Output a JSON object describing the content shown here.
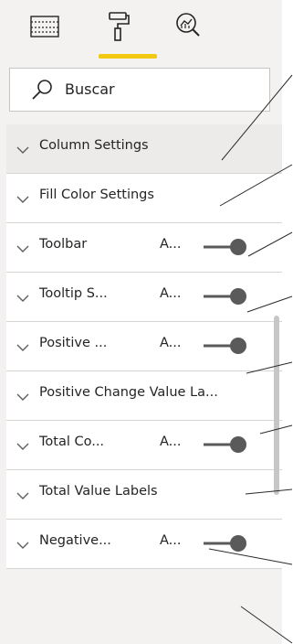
{
  "tabs": [
    {
      "name": "fields-tab",
      "icon": "table-icon",
      "active": false
    },
    {
      "name": "format-tab",
      "icon": "paint-roller-icon",
      "active": true
    },
    {
      "name": "analytics-tab",
      "icon": "analytics-magnifier-icon",
      "active": false
    }
  ],
  "search": {
    "label": "Buscar"
  },
  "cards": [
    {
      "title": "Column Settings",
      "state": "",
      "toggle": false,
      "hover": true
    },
    {
      "title": "Fill Color Settings",
      "state": "",
      "toggle": false,
      "hover": false
    },
    {
      "title": "Toolbar",
      "state": "A...",
      "toggle": true,
      "hover": false
    },
    {
      "title": "Tooltip S...",
      "state": "A...",
      "toggle": true,
      "hover": false
    },
    {
      "title": "Positive ...",
      "state": "A...",
      "toggle": true,
      "hover": false
    },
    {
      "title": "Positive Change Value La...",
      "state": "",
      "toggle": false,
      "hover": false
    },
    {
      "title": "Total Co...",
      "state": "A...",
      "toggle": true,
      "hover": false
    },
    {
      "title": "Total Value Labels",
      "state": "",
      "toggle": false,
      "hover": false
    },
    {
      "title": "Negative...",
      "state": "A...",
      "toggle": true,
      "hover": false
    }
  ],
  "colors": {
    "accent": "#f2c811",
    "toggle": "#5a5a5a",
    "pane": "#f3f2f1"
  }
}
